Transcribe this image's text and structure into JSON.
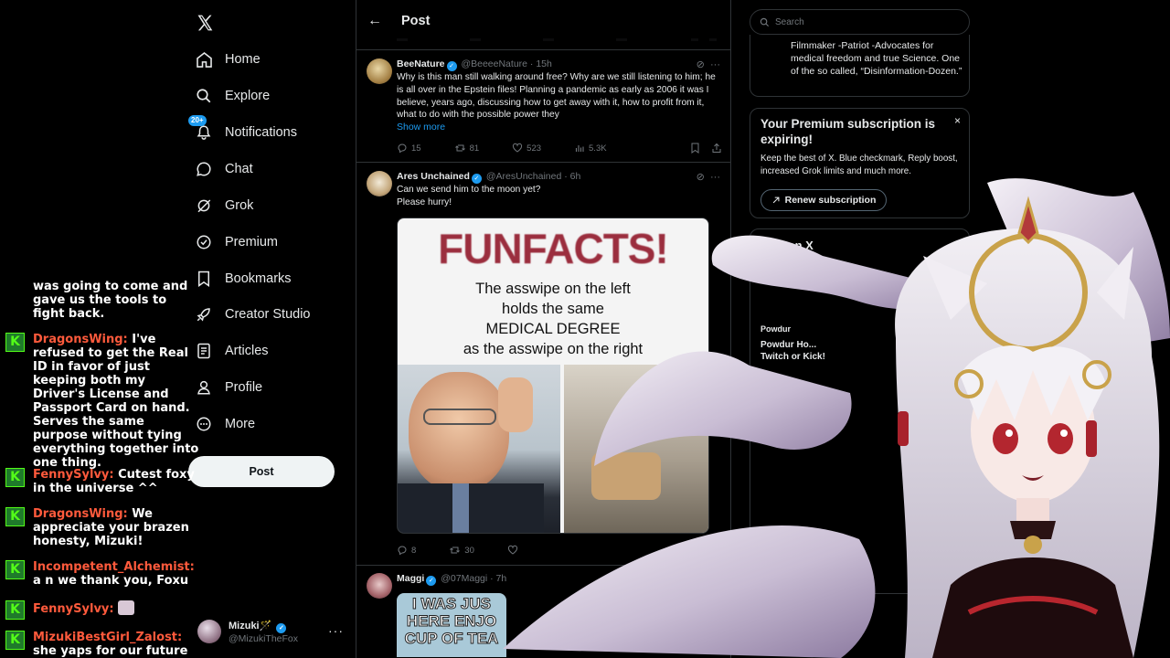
{
  "nav": {
    "items": [
      {
        "label": "Home",
        "icon": "home-icon"
      },
      {
        "label": "Explore",
        "icon": "search-icon"
      },
      {
        "label": "Notifications",
        "icon": "bell-icon",
        "badge": "20+"
      },
      {
        "label": "Chat",
        "icon": "chat-icon"
      },
      {
        "label": "Grok",
        "icon": "grok-icon"
      },
      {
        "label": "Premium",
        "icon": "premium-icon"
      },
      {
        "label": "Bookmarks",
        "icon": "bookmark-icon"
      },
      {
        "label": "Creator Studio",
        "icon": "rocket-icon"
      },
      {
        "label": "Articles",
        "icon": "article-icon"
      },
      {
        "label": "Profile",
        "icon": "profile-icon"
      },
      {
        "label": "More",
        "icon": "more-icon"
      }
    ],
    "post_label": "Post",
    "account": {
      "name": "Mizuki",
      "handle": "@MizukiTheFox",
      "more": "···"
    }
  },
  "chat": {
    "continuation": "was going to come and gave us the tools to fight back.",
    "messages": [
      {
        "user": "DragonsWing:",
        "text": "I've refused to get the Real ID in favor of just keeping both my Driver's License and Passport Card on hand. Serves the same purpose without tying everything together into one thing."
      },
      {
        "user": "FennySylvy:",
        "text": "Cutest foxy in the universe ^^"
      },
      {
        "user": "DragonsWing:",
        "text": "We appreciate your brazen honesty, Mizuki!"
      },
      {
        "user": "Incompetent_Alchemist:",
        "text": "a n we thank you, Foxu"
      },
      {
        "user": "FennySylvy:",
        "text": ""
      },
      {
        "user": "MizukiBestGirl_Zalost:",
        "text": "she yaps for our future"
      }
    ],
    "platform_icon": "K"
  },
  "timeline": {
    "header_title": "Post",
    "tweets": [
      {
        "name": "BeeNature",
        "handle": "@BeeeeNature",
        "time": "15h",
        "text": "Why is this man still walking around free? Why are we still listening to him; he is all over in the Epstein files! Planning a pandemic as early as 2006 it was I believe, years ago, discussing how to get away with it, how to profit from it, what to do with the possible power they",
        "show_more": "Show more",
        "replies": "15",
        "reposts": "81",
        "likes": "523",
        "views": "5.3K"
      },
      {
        "name": "Ares Unchained",
        "handle": "@AresUnchained",
        "time": "6h",
        "text_line1": "Can we send him to the moon yet?",
        "text_line2": "Please hurry!",
        "meme_title": "FUNFACTS!",
        "meme_caption": [
          "The asswipe on the left",
          "holds the same",
          "MEDICAL DEGREE",
          "as the asswipe on the right"
        ],
        "replies": "8",
        "reposts": "30"
      },
      {
        "name": "Maggi",
        "handle": "@07Maggi",
        "time": "7h",
        "meme_text": [
          "I WAS JUS",
          "HERE ENJO",
          "CUP OF TEA"
        ]
      }
    ]
  },
  "right": {
    "search_placeholder": "Search",
    "bio": "Filmmaker -Patriot -Advocates for medical freedom and true Science. One of the so called, “Disinformation-Dozen.”",
    "premium": {
      "title": "Your Premium subscription is expiring!",
      "text": "Keep the best of X. Blue checkmark, Reply boost, increased Grok limits and much more.",
      "button": "Renew subscription",
      "close": "×"
    },
    "live": {
      "title": "Live on X",
      "host": "Powdur",
      "desc": "Powdur Ho... Twitch or Kick!"
    }
  },
  "colors": {
    "accent": "#1d9bf0",
    "chat_username": "#ff5a3c",
    "kick_green": "#53fc18",
    "meme_title": "#9b2e3e"
  }
}
